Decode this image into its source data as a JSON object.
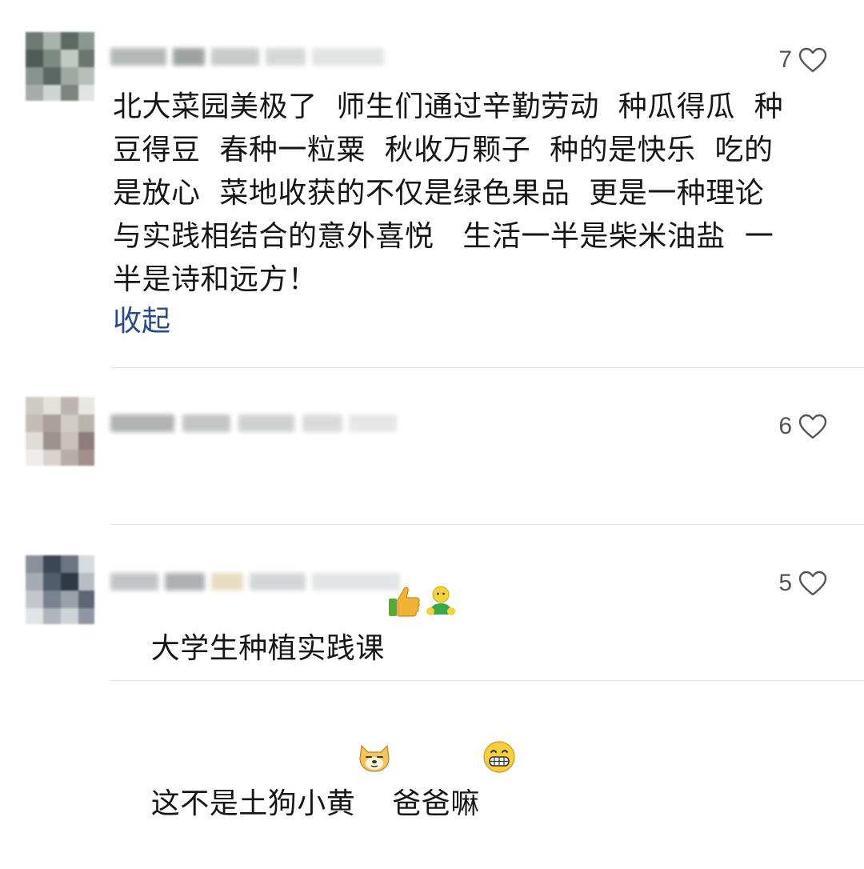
{
  "comments": [
    {
      "likes": "7",
      "text": "北大菜园美极了  师生们通过辛勤劳动  种瓜得瓜  种\n豆得豆  春种一粒粟  秋收万颗子  种的是快乐  吃的\n是放心  菜地收获的不仅是绿色果品  更是一种理论\n与实践相结合的意外喜悦   生活一半是柴米油盐  一\n半是诗和远方！",
      "collapse_label": "收起"
    },
    {
      "likes": "6",
      "text": "大学生种植实践课",
      "emojis": [
        "thumbs-up-icon",
        "green-figure-icon"
      ]
    },
    {
      "likes": "5",
      "text_a": "这不是土狗小黄",
      "text_b": "爸爸嘛",
      "emojis": [
        "dog-face-icon",
        "grinning-face-icon"
      ]
    }
  ],
  "colors": {
    "link": "#2a4a8a",
    "text": "#161616",
    "like_count": "#555555",
    "divider": "#e3e3e3"
  }
}
